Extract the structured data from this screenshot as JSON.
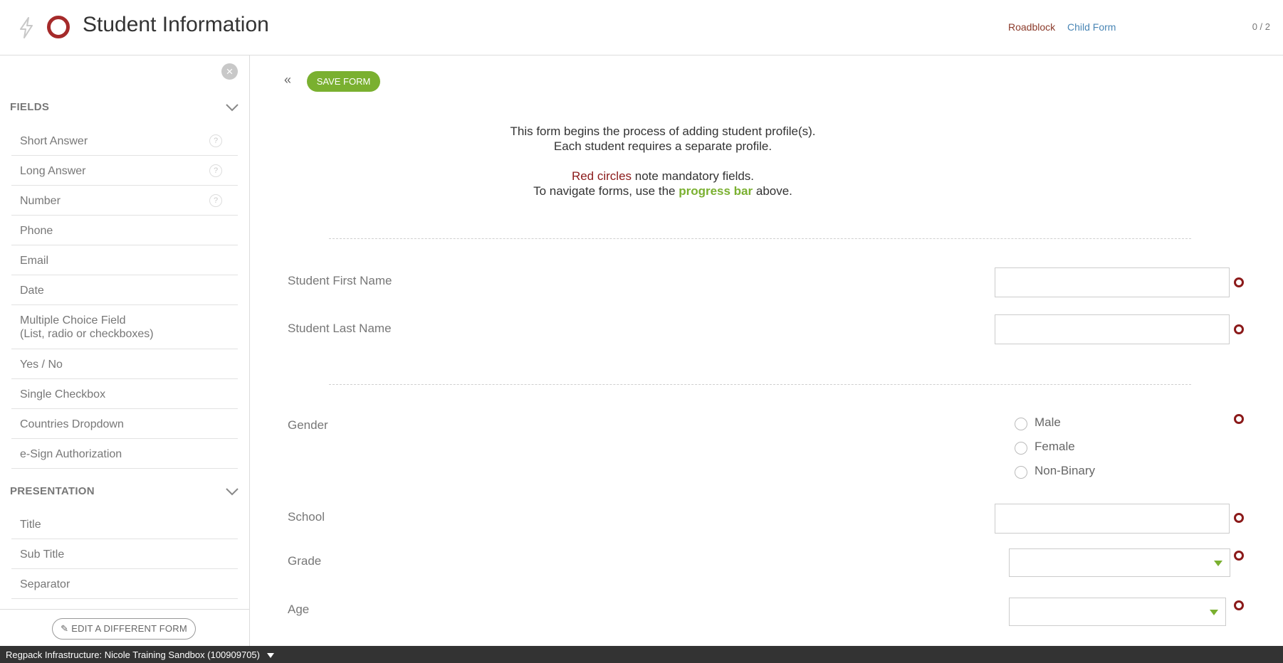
{
  "header": {
    "title": "Student Information",
    "links": {
      "roadblock": "Roadblock",
      "child_form": "Child Form"
    },
    "progress": "0 / 2"
  },
  "sidebar": {
    "close_symbol": "×",
    "fields_heading": "FIELDS",
    "fields": [
      {
        "label": "Short Answer",
        "help": "?"
      },
      {
        "label": "Long Answer",
        "help": "?"
      },
      {
        "label": "Number",
        "help": "?"
      },
      {
        "label": "Phone"
      },
      {
        "label": "Email"
      },
      {
        "label": "Date"
      },
      {
        "label": "Multiple Choice Field",
        "label2": "(List, radio or checkboxes)"
      },
      {
        "label": "Yes / No"
      },
      {
        "label": "Single Checkbox"
      },
      {
        "label": "Countries Dropdown"
      },
      {
        "label": "e-Sign Authorization"
      }
    ],
    "presentation_heading": "PRESENTATION",
    "presentation": [
      {
        "label": "Title"
      },
      {
        "label": "Sub Title"
      },
      {
        "label": "Separator"
      }
    ],
    "edit_form_button": "EDIT A DIFFERENT FORM"
  },
  "main": {
    "collapse_symbol": "«",
    "save_button": "SAVE FORM",
    "intro": {
      "line1": "This form begins the process of adding student profile(s).",
      "line2": "Each student requires a separate profile.",
      "red_text": "Red circles",
      "line3_rest": " note mandatory fields.",
      "line4_pre": "To navigate forms, use the ",
      "green_text": "progress bar",
      "line4_post": " above."
    },
    "fields": {
      "first_name": "Student First Name",
      "last_name": "Student Last Name",
      "gender": "Gender",
      "gender_options": [
        "Male",
        "Female",
        "Non-Binary"
      ],
      "school": "School",
      "grade": "Grade",
      "age": "Age"
    }
  },
  "bottom_bar": {
    "text": "Regpack Infrastructure: Nicole Training Sandbox (100909705)"
  },
  "colors": {
    "accent_green": "#7ab030",
    "required_red": "#8b1a1a",
    "brand_ring": "#a52a2a"
  }
}
